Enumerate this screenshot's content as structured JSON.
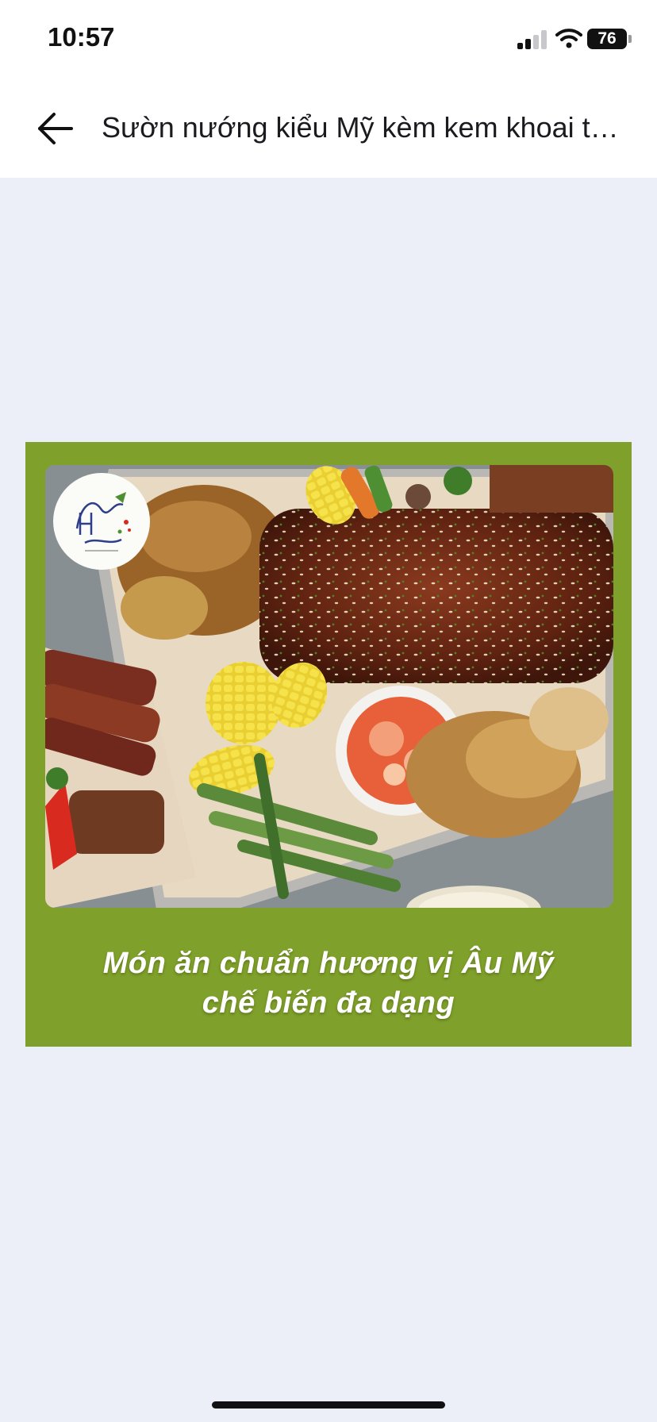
{
  "status_bar": {
    "time": "10:57",
    "battery_level": "76",
    "icons": [
      "cellular-signal-icon",
      "wifi-icon",
      "battery-icon"
    ]
  },
  "header": {
    "back_icon": "arrow-left-icon",
    "title": "Sườn nướng kiểu Mỹ kèm kem khoai tây và kim chi"
  },
  "banner": {
    "background_color": "#7fa02a",
    "caption_line1": "Món ăn chuẩn hương vị Âu Mỹ",
    "caption_line2": "chế biến đa dạng",
    "logo_text": "Healthy Carrot"
  },
  "colors": {
    "page_background": "#eceff7",
    "header_background": "#ffffff",
    "accent_green": "#7fa02a"
  }
}
